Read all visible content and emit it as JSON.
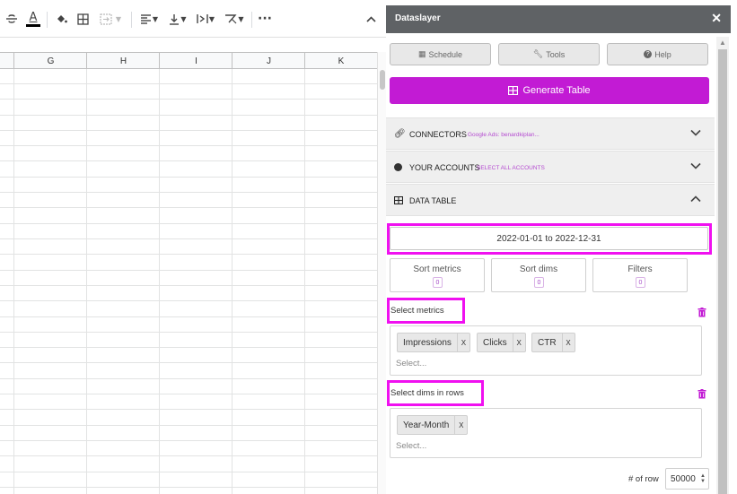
{
  "sheet": {
    "columns": [
      "G",
      "H",
      "I",
      "J",
      "K"
    ],
    "toolbar_icons": [
      "strikethrough-icon",
      "text-color-icon",
      "fill-color-icon",
      "borders-icon",
      "merge-cells-icon",
      "horizontal-align-icon",
      "vertical-align-icon",
      "text-wrap-icon",
      "text-rotation-icon",
      "more-icon",
      "collapse-toolbar-icon"
    ],
    "text_color_glyph": "A",
    "more_glyph": "···",
    "collapse_glyph": "^"
  },
  "sidebar": {
    "title": "Dataslayer",
    "close": "✕",
    "buttons": {
      "schedule": "Schedule",
      "tools": "Tools",
      "help": "Help"
    },
    "generate": "Generate Table",
    "sections": {
      "connectors": {
        "title": "CONNECTORS",
        "subtitle": "Google Ads: benardkiplan..."
      },
      "accounts": {
        "title": "YOUR ACCOUNTS",
        "subtitle": "SELECT ALL ACCOUNTS"
      },
      "data_table": {
        "title": "DATA TABLE"
      }
    },
    "date_range": "2022-01-01 to 2022-12-31",
    "options": [
      {
        "label": "Sort metrics",
        "count": "0"
      },
      {
        "label": "Sort dims",
        "count": "0"
      },
      {
        "label": "Filters",
        "count": "0"
      }
    ],
    "metrics": {
      "label": "Select metrics",
      "chips": [
        "Impressions",
        "Clicks",
        "CTR"
      ],
      "chip_remove": "X",
      "placeholder": "Select..."
    },
    "dims": {
      "label": "Select dims in rows",
      "chips": [
        "Year-Month"
      ],
      "chip_remove": "X",
      "placeholder": "Select..."
    },
    "rows": {
      "label": "# of row",
      "value": "50000"
    },
    "colors": {
      "accent": "#c21bd4",
      "highlight": "#f010f0",
      "header": "#5f6265"
    }
  }
}
